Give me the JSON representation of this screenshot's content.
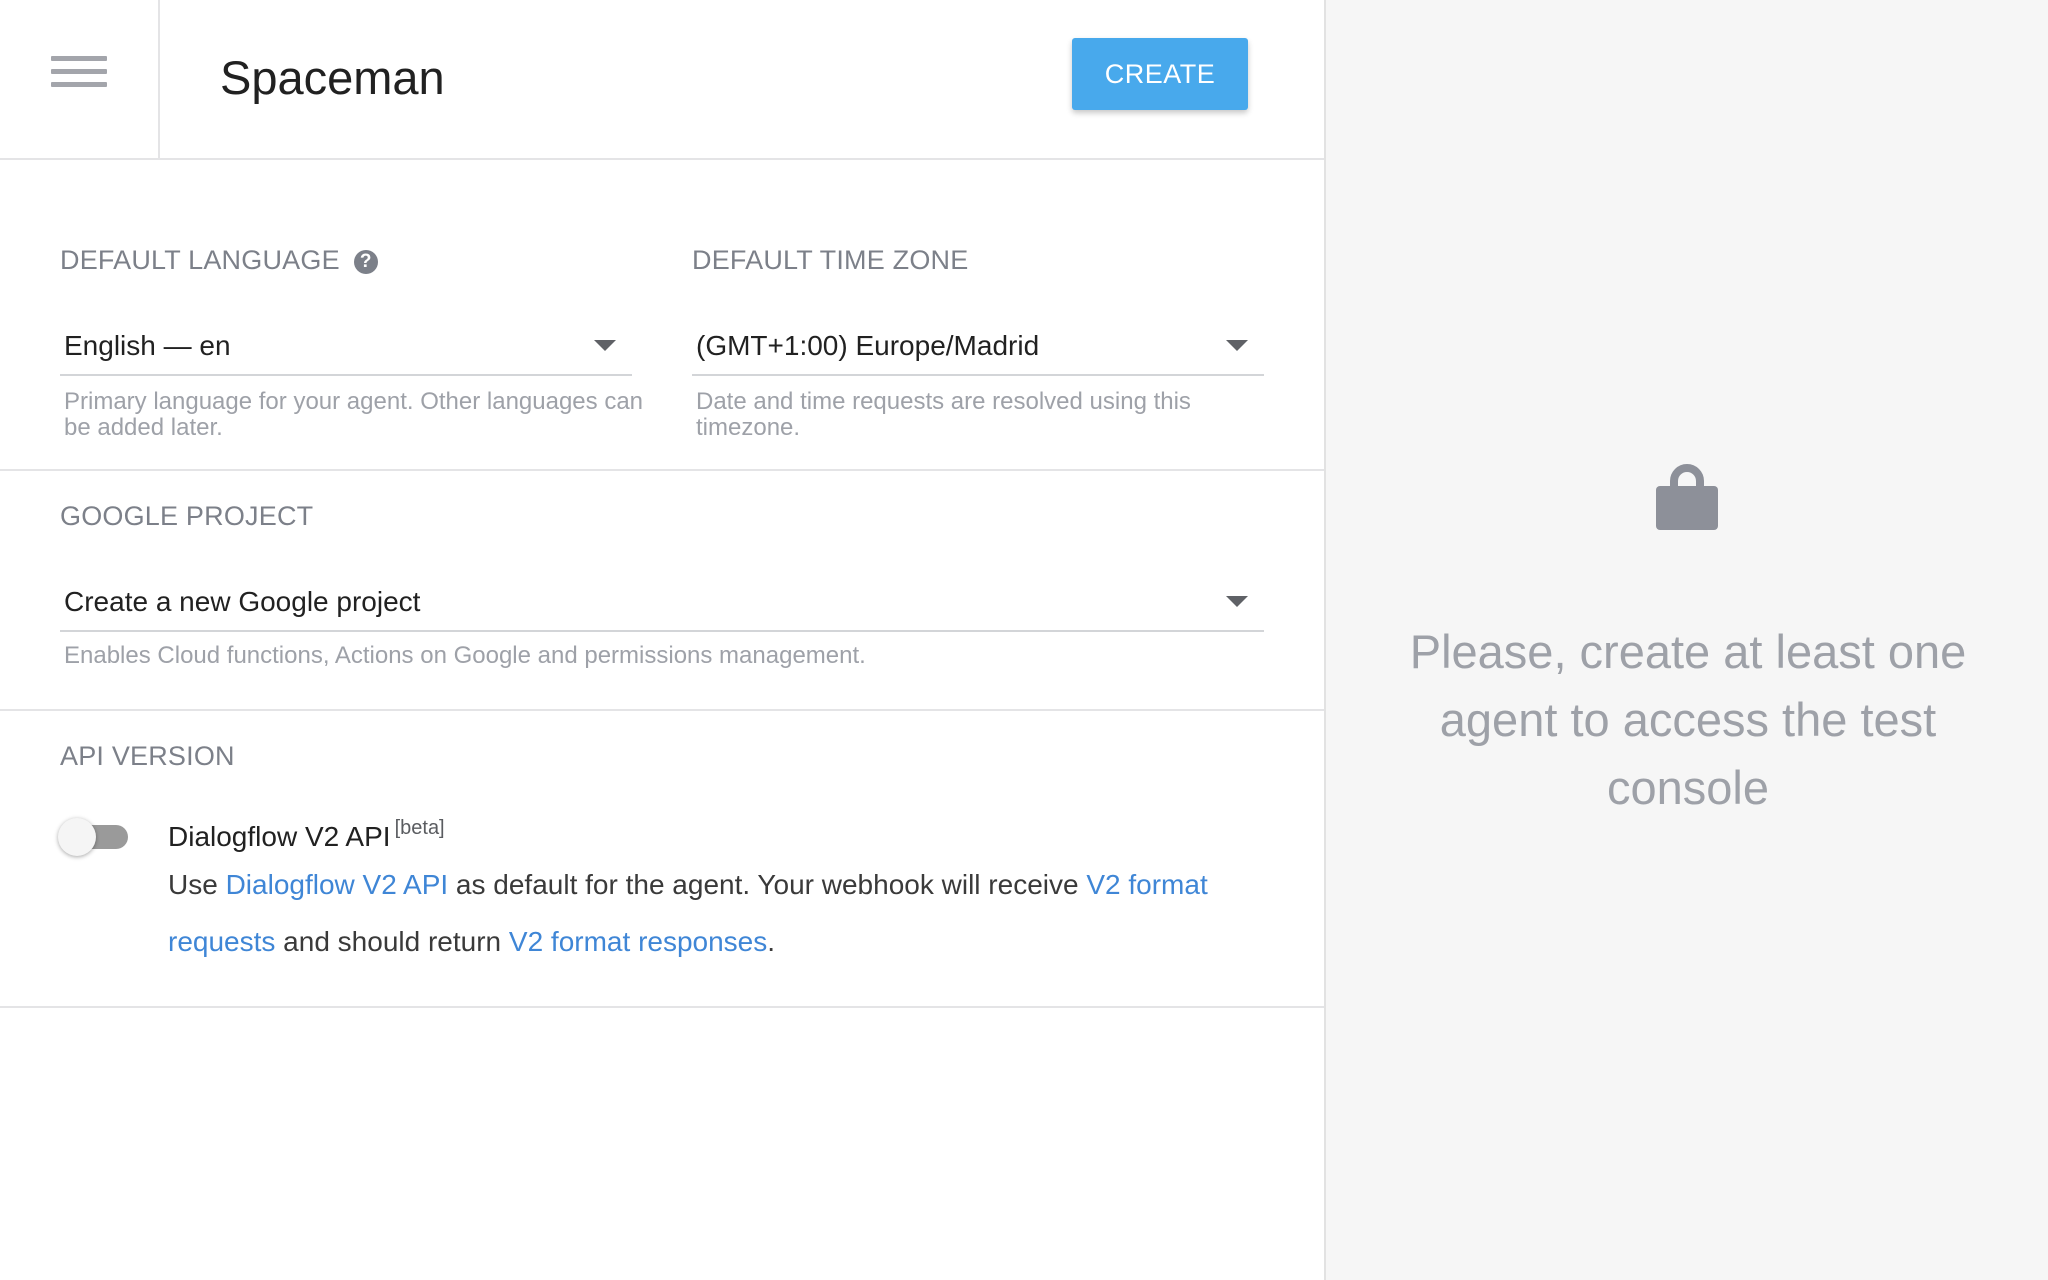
{
  "header": {
    "agent_name": "Spaceman",
    "create_label": "CREATE"
  },
  "language": {
    "label": "DEFAULT LANGUAGE",
    "help_glyph": "?",
    "value": "English — en",
    "hint": "Primary language for your agent. Other languages can be added later."
  },
  "timezone": {
    "label": "DEFAULT TIME ZONE",
    "value": "(GMT+1:00) Europe/Madrid",
    "hint": "Date and time requests are resolved using this timezone."
  },
  "google_project": {
    "label": "GOOGLE PROJECT",
    "value": "Create a new Google project",
    "hint": "Enables Cloud functions, Actions on Google and permissions management."
  },
  "api_version": {
    "label": "API VERSION",
    "toggle_on": false,
    "title": "Dialogflow V2 API",
    "badge": "[beta]",
    "desc_1": "Use ",
    "link_1": "Dialogflow V2 API",
    "desc_2": " as default for the agent. Your webhook will receive ",
    "link_2": "V2 format requests",
    "desc_3": " and should return ",
    "link_3": "V2 format responses",
    "desc_4": "."
  },
  "console": {
    "icon": "lock-icon",
    "message": "Please, create at least one agent to access the test console"
  },
  "colors": {
    "accent": "#48a9ec",
    "link": "#3f86d6",
    "label": "#7c8089",
    "console_bg": "#f6f6f6"
  }
}
